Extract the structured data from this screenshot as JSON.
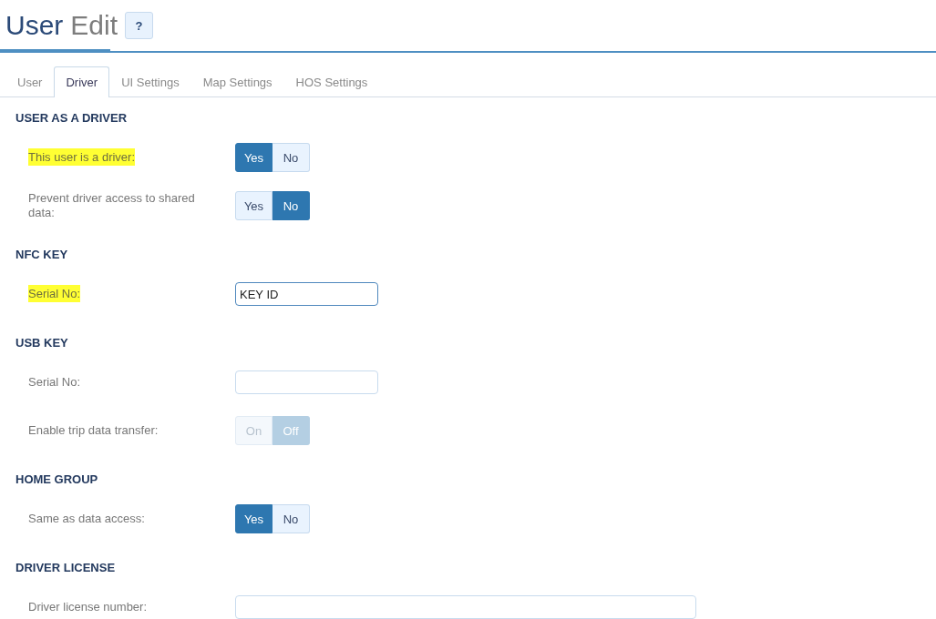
{
  "header": {
    "title_primary": "User",
    "title_secondary": "Edit",
    "help_button": "?"
  },
  "tabs": [
    {
      "label": "User",
      "selected": false
    },
    {
      "label": "Driver",
      "selected": true
    },
    {
      "label": "UI Settings",
      "selected": false
    },
    {
      "label": "Map Settings",
      "selected": false
    },
    {
      "label": "HOS Settings",
      "selected": false
    }
  ],
  "sections": [
    {
      "heading": "USER AS A DRIVER",
      "rows": [
        {
          "kind": "toggle",
          "label": "This user is a driver:",
          "highlighted": true,
          "disabled": false,
          "options": [
            {
              "label": "Yes",
              "selected": true
            },
            {
              "label": "No",
              "selected": false
            }
          ]
        },
        {
          "kind": "toggle",
          "label": "Prevent driver access to shared data:",
          "highlighted": false,
          "disabled": false,
          "options": [
            {
              "label": "Yes",
              "selected": false
            },
            {
              "label": "No",
              "selected": true
            }
          ]
        }
      ]
    },
    {
      "heading": "NFC KEY",
      "rows": [
        {
          "kind": "text",
          "label": "Serial No:",
          "highlighted": true,
          "value": "KEY ID",
          "focused": true
        }
      ]
    },
    {
      "heading": "USB KEY",
      "rows": [
        {
          "kind": "text",
          "label": "Serial No:",
          "highlighted": false,
          "focused": false
        },
        {
          "kind": "toggle",
          "label": "Enable trip data transfer:",
          "highlighted": false,
          "disabled": true,
          "options": [
            {
              "label": "On",
              "selected": false
            },
            {
              "label": "Off",
              "selected": true
            }
          ]
        }
      ]
    },
    {
      "heading": "HOME GROUP",
      "rows": [
        {
          "kind": "toggle",
          "label": "Same as data access:",
          "highlighted": false,
          "disabled": false,
          "options": [
            {
              "label": "Yes",
              "selected": true
            },
            {
              "label": "No",
              "selected": false
            }
          ]
        }
      ]
    },
    {
      "heading": "DRIVER LICENSE",
      "rows": [
        {
          "kind": "wide_text",
          "label": "Driver license number:",
          "highlighted": false,
          "focused": false
        }
      ]
    }
  ]
}
